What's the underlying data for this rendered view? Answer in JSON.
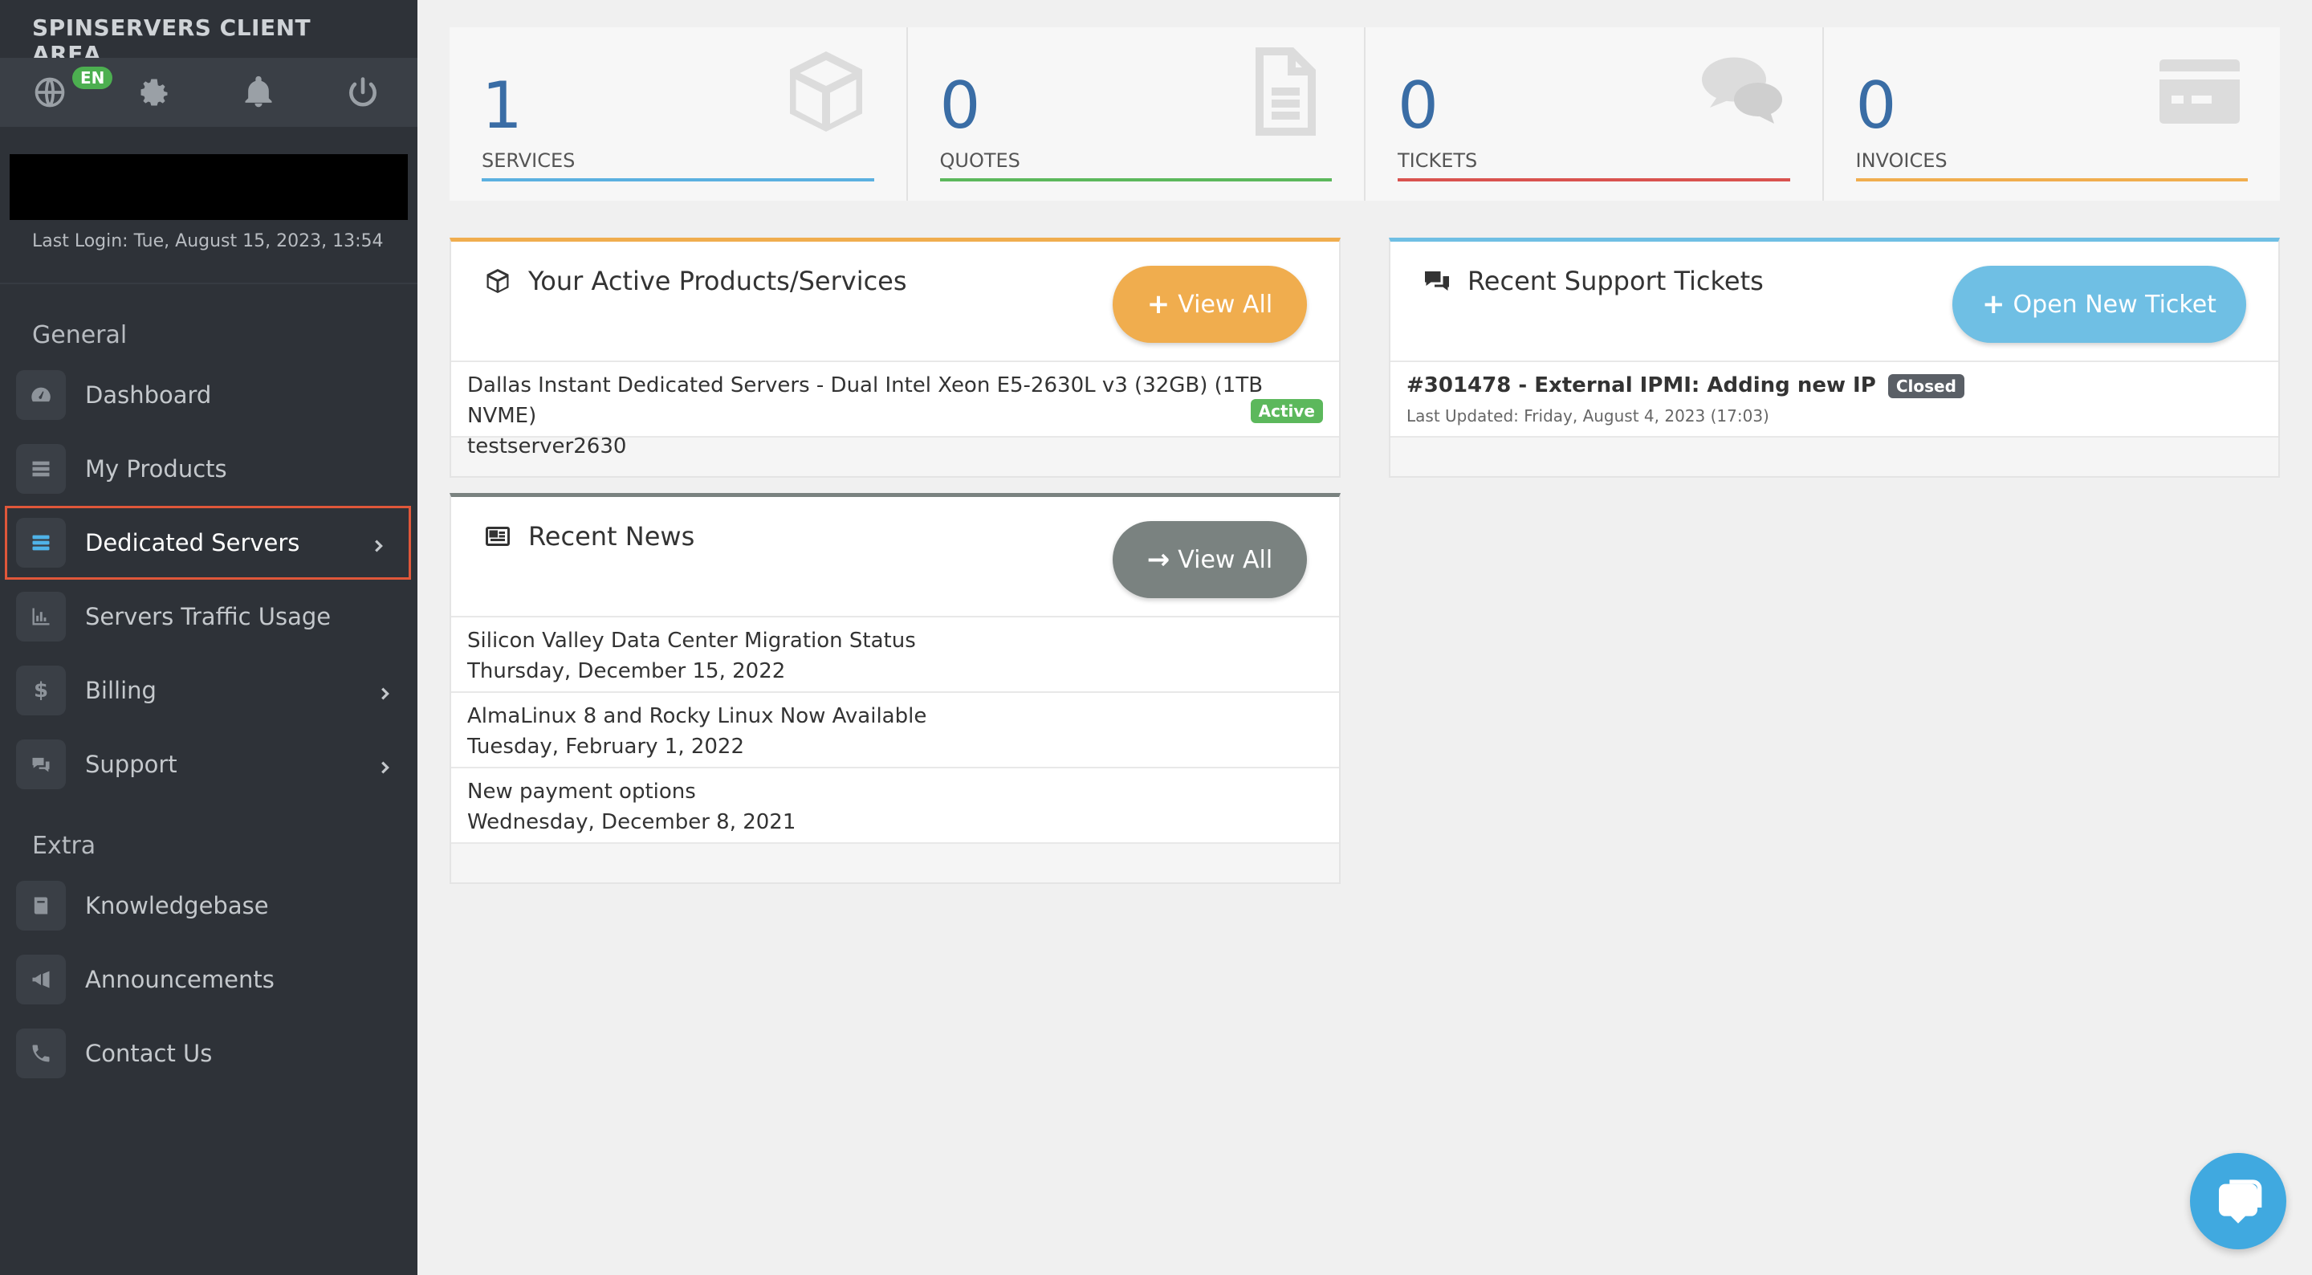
{
  "sidebar": {
    "brand": "SPINSERVERS CLIENT AREA",
    "language_badge": "EN",
    "last_login": "Last Login: Tue, August 15, 2023, 13:54",
    "sections": {
      "general": "General",
      "extra": "Extra"
    },
    "general_items": [
      {
        "label": "Dashboard",
        "icon": "dashboard-icon"
      },
      {
        "label": "My Products",
        "icon": "products-icon"
      },
      {
        "label": "Dedicated Servers",
        "icon": "servers-icon",
        "active": true
      },
      {
        "label": "Servers Traffic Usage",
        "icon": "chart-icon"
      },
      {
        "label": "Billing",
        "icon": "dollar-icon"
      },
      {
        "label": "Support",
        "icon": "chat-icon"
      }
    ],
    "extra_items": [
      {
        "label": "Knowledgebase",
        "icon": "book-icon"
      },
      {
        "label": "Announcements",
        "icon": "megaphone-icon"
      },
      {
        "label": "Contact Us",
        "icon": "phone-icon"
      }
    ]
  },
  "stats": [
    {
      "value": "1",
      "label": "SERVICES",
      "color": "#5bb0e0",
      "icon": "cube-icon"
    },
    {
      "value": "0",
      "label": "QUOTES",
      "color": "#5cb85c",
      "icon": "document-icon"
    },
    {
      "value": "0",
      "label": "TICKETS",
      "color": "#d9534f",
      "icon": "comments-icon"
    },
    {
      "value": "0",
      "label": "INVOICES",
      "color": "#f0ad4e",
      "icon": "credit-card-icon"
    }
  ],
  "products_panel": {
    "title": "Your Active Products/Services",
    "button_label": "View All",
    "button_color": "#f0ad4e",
    "items": [
      {
        "name": "Dallas Instant Dedicated Servers - Dual Intel Xeon E5-2630L v3 (32GB) (1TB NVME)",
        "hostname": "testserver2630",
        "status": "Active",
        "status_color": "#5cb85c"
      }
    ]
  },
  "tickets_panel": {
    "title": "Recent Support Tickets",
    "button_label": "Open New Ticket",
    "button_color": "#6fbfe4",
    "items": [
      {
        "subject": "#301478 - External IPMI: Adding new IP",
        "status": "Closed",
        "updated": "Last Updated: Friday, August 4, 2023 (17:03)"
      }
    ]
  },
  "news_panel": {
    "title": "Recent News",
    "button_label": "View All",
    "button_color": "#7a8280",
    "items": [
      {
        "title": "Silicon Valley Data Center Migration Status",
        "date": "Thursday, December 15, 2022"
      },
      {
        "title": "AlmaLinux 8 and Rocky Linux Now Available",
        "date": "Tuesday, February 1, 2022"
      },
      {
        "title": "New payment options",
        "date": "Wednesday, December 8, 2021"
      }
    ]
  }
}
